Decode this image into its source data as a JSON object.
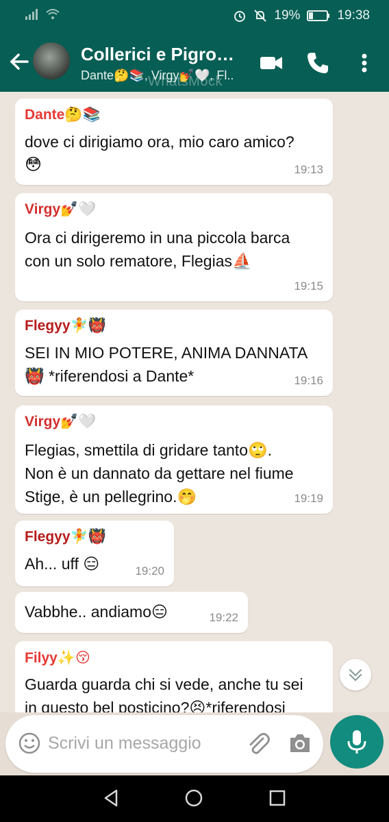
{
  "status_bar": {
    "battery": "19%",
    "time": "19:38"
  },
  "header": {
    "title": "Collerici e Pigron...",
    "subtitle": "Dante🤔📚, Virgy💅🤍, Fl..",
    "watermark": "WhatsMock"
  },
  "messages": [
    {
      "sender": "Dante🤔📚",
      "sender_color": "#e53935",
      "text_lines": [
        "dove ci dirigiamo ora, mio caro amico?",
        "😳"
      ],
      "time": "19:13"
    },
    {
      "sender": "Virgy💅🤍",
      "sender_color": "#d32f2f",
      "text_lines": [
        "Ora ci dirigeremo in una piccola barca",
        "con un solo rematore, Flegias⛵"
      ],
      "time": "19:15"
    },
    {
      "sender": "Flegyy🧚👹",
      "sender_color": "#b71c1c",
      "text_lines": [
        "SEI IN MIO POTERE, ANIMA DANNATA",
        "👹 *riferendosi a Dante*"
      ],
      "time": "19:16"
    },
    {
      "sender": "Virgy💅🤍",
      "sender_color": "#d32f2f",
      "text_lines": [
        "Flegias, smettila di gridare tanto🙄.",
        "Non è un dannato da gettare nel fiume",
        "Stige, è un pellegrino.🤭"
      ],
      "time": "19:19"
    },
    {
      "sender": "Flegyy🧚👹",
      "sender_color": "#b71c1c",
      "text_lines": [
        "Ah... uff 😑"
      ],
      "time": "19:20"
    },
    {
      "sender": "",
      "sender_color": "",
      "text_lines": [
        "Vabbhe.. andiamo😑"
      ],
      "time": "19:22"
    },
    {
      "sender": "Filyy✨😚",
      "sender_color": "#e53935",
      "text_lines": [
        "Guarda guarda chi si vede, anche tu sei",
        "in questo bel posticino?😣*riferendosi"
      ],
      "time": ""
    }
  ],
  "composer": {
    "placeholder": "Scrivi un messaggio"
  },
  "icons": {
    "back": "arrow-left-icon",
    "video": "videocam-icon",
    "call": "phone-icon",
    "menu": "more-vert-icon",
    "emoji": "smiley-icon",
    "attach": "paperclip-icon",
    "camera": "camera-icon",
    "mic": "mic-icon",
    "scroll": "chevron-double-down-icon"
  },
  "colors": {
    "header": "#075e54",
    "mic": "#128c7e",
    "chat_bg": "#ece5dd"
  }
}
